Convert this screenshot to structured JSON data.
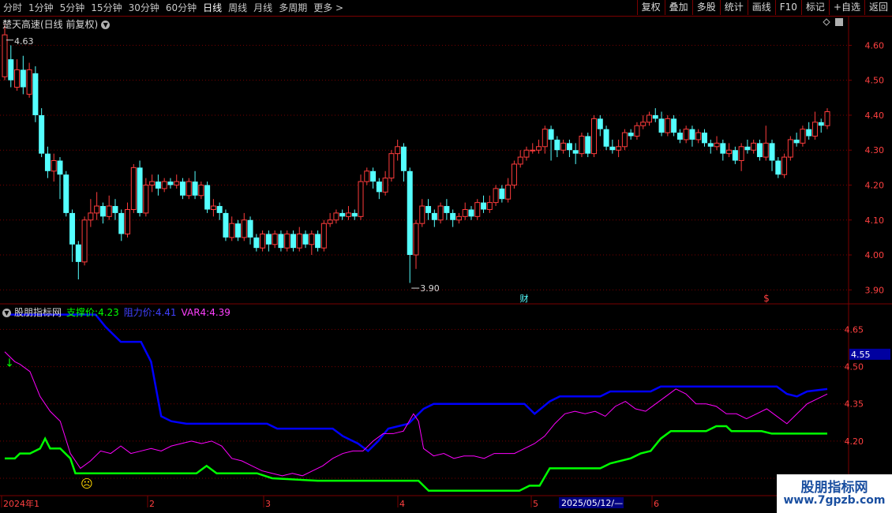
{
  "toolbar": {
    "periods": [
      "分时",
      "1分钟",
      "5分钟",
      "15分钟",
      "30分钟",
      "60分钟",
      "日线",
      "周线",
      "月线",
      "多周期",
      "更多 >"
    ],
    "active_index": 6,
    "right_buttons": [
      "复权",
      "叠加",
      "多股",
      "统计",
      "画线",
      "F10",
      "标记",
      "+自选",
      "返回"
    ]
  },
  "main": {
    "title": "楚天高速(日线 前复权)",
    "high_label": "4.63",
    "low_label": "3.90",
    "axis_ticks": [
      "4.60",
      "4.50",
      "4.40",
      "4.30",
      "4.20",
      "4.10",
      "4.00",
      "3.90"
    ],
    "marker_cai": "财",
    "marker_s": "$"
  },
  "indicator": {
    "name": "股朋指标网",
    "support_label": "支撑价:",
    "support_value": "4.23",
    "resist_label": "阻力价:",
    "resist_value": "4.41",
    "var4_label": "VAR4:",
    "var4_value": "4.39",
    "axis_ticks": [
      "4.65",
      "4.50",
      "4.35",
      "4.20",
      "4.05"
    ],
    "current_tag": "4.55",
    "face": "☹",
    "arrow": "↓"
  },
  "date_axis": {
    "labels": [
      "2024年1",
      "2",
      "3",
      "4",
      "5",
      "6"
    ],
    "highlight": "2025/05/12/—"
  },
  "watermark": {
    "line1": "股朋指标网",
    "line2": "www.7gpzb.com"
  },
  "colors": {
    "up": "#ff3c3c",
    "down": "#54ffff",
    "support": "#00ff00",
    "resist": "#0000ff",
    "var4": "#ff00ff",
    "grid": "#7a0000"
  },
  "chart_data": {
    "type": "candlestick",
    "price_range": [
      3.86,
      4.68
    ],
    "candles": [
      [
        4.51,
        4.63,
        4.66,
        4.5
      ],
      [
        4.56,
        4.5,
        4.6,
        4.48
      ],
      [
        4.48,
        4.53,
        4.56,
        4.47
      ],
      [
        4.53,
        4.48,
        4.57,
        4.46
      ],
      [
        4.46,
        4.53,
        4.55,
        4.45
      ],
      [
        4.52,
        4.4,
        4.54,
        4.38
      ],
      [
        4.4,
        4.29,
        4.42,
        4.28
      ],
      [
        4.29,
        4.24,
        4.31,
        4.22
      ],
      [
        4.24,
        4.27,
        4.29,
        4.21
      ],
      [
        4.27,
        4.23,
        4.28,
        4.16
      ],
      [
        4.23,
        4.12,
        4.24,
        4.11
      ],
      [
        4.12,
        4.03,
        4.13,
        3.98
      ],
      [
        4.03,
        3.98,
        4.04,
        3.93
      ],
      [
        3.98,
        4.1,
        4.11,
        3.97
      ],
      [
        4.1,
        4.12,
        4.16,
        4.08
      ],
      [
        4.12,
        4.14,
        4.18,
        4.1
      ],
      [
        4.14,
        4.11,
        4.15,
        4.09
      ],
      [
        4.11,
        4.14,
        4.17,
        4.1
      ],
      [
        4.14,
        4.12,
        4.16,
        4.1
      ],
      [
        4.12,
        4.06,
        4.13,
        4.04
      ],
      [
        4.06,
        4.13,
        4.15,
        4.05
      ],
      [
        4.13,
        4.25,
        4.26,
        4.12
      ],
      [
        4.25,
        4.12,
        4.27,
        4.11
      ],
      [
        4.12,
        4.2,
        4.22,
        4.11
      ],
      [
        4.2,
        4.21,
        4.23,
        4.18
      ],
      [
        4.21,
        4.19,
        4.23,
        4.17
      ],
      [
        4.19,
        4.21,
        4.22,
        4.18
      ],
      [
        4.21,
        4.2,
        4.22,
        4.19
      ],
      [
        4.2,
        4.21,
        4.23,
        4.19
      ],
      [
        4.21,
        4.17,
        4.22,
        4.16
      ],
      [
        4.17,
        4.21,
        4.22,
        4.16
      ],
      [
        4.21,
        4.17,
        4.24,
        4.16
      ],
      [
        4.17,
        4.2,
        4.21,
        4.16
      ],
      [
        4.2,
        4.13,
        4.21,
        4.12
      ],
      [
        4.13,
        4.14,
        4.16,
        4.11
      ],
      [
        4.14,
        4.12,
        4.15,
        4.1
      ],
      [
        4.12,
        4.05,
        4.13,
        4.04
      ],
      [
        4.05,
        4.09,
        4.11,
        4.04
      ],
      [
        4.09,
        4.05,
        4.1,
        4.04
      ],
      [
        4.05,
        4.1,
        4.12,
        4.04
      ],
      [
        4.1,
        4.05,
        4.11,
        4.03
      ],
      [
        4.05,
        4.02,
        4.06,
        4.01
      ],
      [
        4.02,
        4.06,
        4.07,
        4.01
      ],
      [
        4.06,
        4.03,
        4.07,
        4.01
      ],
      [
        4.03,
        4.06,
        4.07,
        4.02
      ],
      [
        4.06,
        4.02,
        4.07,
        4.01
      ],
      [
        4.02,
        4.06,
        4.07,
        4.01
      ],
      [
        4.06,
        4.02,
        4.07,
        4.01
      ],
      [
        4.02,
        4.06,
        4.08,
        4.01
      ],
      [
        4.06,
        4.03,
        4.07,
        4.02
      ],
      [
        4.03,
        4.06,
        4.07,
        4.0
      ],
      [
        4.06,
        4.02,
        4.07,
        4.01
      ],
      [
        4.02,
        4.09,
        4.1,
        4.01
      ],
      [
        4.09,
        4.1,
        4.12,
        4.08
      ],
      [
        4.1,
        4.12,
        4.13,
        4.09
      ],
      [
        4.12,
        4.11,
        4.13,
        4.1
      ],
      [
        4.11,
        4.12,
        4.14,
        4.1
      ],
      [
        4.12,
        4.11,
        4.13,
        4.1
      ],
      [
        4.11,
        4.21,
        4.23,
        4.1
      ],
      [
        4.21,
        4.24,
        4.25,
        4.2
      ],
      [
        4.24,
        4.21,
        4.25,
        4.19
      ],
      [
        4.21,
        4.18,
        4.22,
        4.16
      ],
      [
        4.18,
        4.22,
        4.24,
        4.17
      ],
      [
        4.22,
        4.29,
        4.3,
        4.21
      ],
      [
        4.29,
        4.31,
        4.33,
        4.27
      ],
      [
        4.31,
        4.24,
        4.32,
        4.21
      ],
      [
        4.24,
        4.0,
        4.25,
        3.92
      ],
      [
        4.0,
        4.09,
        4.1,
        3.96
      ],
      [
        4.09,
        4.14,
        4.16,
        4.08
      ],
      [
        4.14,
        4.12,
        4.16,
        4.1
      ],
      [
        4.12,
        4.1,
        4.13,
        4.08
      ],
      [
        4.1,
        4.14,
        4.15,
        4.09
      ],
      [
        4.14,
        4.12,
        4.16,
        4.1
      ],
      [
        4.12,
        4.1,
        4.13,
        4.08
      ],
      [
        4.1,
        4.11,
        4.12,
        4.09
      ],
      [
        4.11,
        4.13,
        4.15,
        4.1
      ],
      [
        4.13,
        4.11,
        4.14,
        4.1
      ],
      [
        4.11,
        4.15,
        4.16,
        4.1
      ],
      [
        4.15,
        4.13,
        4.17,
        4.12
      ],
      [
        4.13,
        4.15,
        4.17,
        4.12
      ],
      [
        4.15,
        4.19,
        4.2,
        4.14
      ],
      [
        4.19,
        4.16,
        4.2,
        4.15
      ],
      [
        4.16,
        4.2,
        4.22,
        4.15
      ],
      [
        4.2,
        4.26,
        4.27,
        4.19
      ],
      [
        4.26,
        4.28,
        4.3,
        4.25
      ],
      [
        4.28,
        4.3,
        4.31,
        4.27
      ],
      [
        4.3,
        4.3,
        4.32,
        4.29
      ],
      [
        4.3,
        4.31,
        4.33,
        4.29
      ],
      [
        4.31,
        4.36,
        4.37,
        4.29
      ],
      [
        4.36,
        4.33,
        4.37,
        4.27
      ],
      [
        4.33,
        4.3,
        4.34,
        4.28
      ],
      [
        4.3,
        4.32,
        4.33,
        4.29
      ],
      [
        4.32,
        4.3,
        4.33,
        4.28
      ],
      [
        4.3,
        4.29,
        4.32,
        4.26
      ],
      [
        4.29,
        4.34,
        4.35,
        4.28
      ],
      [
        4.34,
        4.29,
        4.35,
        4.28
      ],
      [
        4.29,
        4.39,
        4.4,
        4.28
      ],
      [
        4.39,
        4.36,
        4.4,
        4.34
      ],
      [
        4.36,
        4.31,
        4.37,
        4.3
      ],
      [
        4.31,
        4.3,
        4.33,
        4.29
      ],
      [
        4.3,
        4.31,
        4.33,
        4.28
      ],
      [
        4.31,
        4.35,
        4.36,
        4.3
      ],
      [
        4.35,
        4.34,
        4.36,
        4.33
      ],
      [
        4.34,
        4.37,
        4.38,
        4.33
      ],
      [
        4.37,
        4.38,
        4.4,
        4.36
      ],
      [
        4.38,
        4.4,
        4.41,
        4.37
      ],
      [
        4.4,
        4.39,
        4.42,
        4.38
      ],
      [
        4.39,
        4.35,
        4.41,
        4.34
      ],
      [
        4.35,
        4.39,
        4.4,
        4.34
      ],
      [
        4.39,
        4.35,
        4.4,
        4.34
      ],
      [
        4.35,
        4.33,
        4.36,
        4.32
      ],
      [
        4.33,
        4.36,
        4.37,
        4.32
      ],
      [
        4.36,
        4.33,
        4.37,
        4.31
      ],
      [
        4.33,
        4.35,
        4.36,
        4.32
      ],
      [
        4.35,
        4.32,
        4.36,
        4.31
      ],
      [
        4.32,
        4.31,
        4.33,
        4.29
      ],
      [
        4.31,
        4.32,
        4.34,
        4.3
      ],
      [
        4.32,
        4.29,
        4.33,
        4.27
      ],
      [
        4.29,
        4.3,
        4.32,
        4.28
      ],
      [
        4.3,
        4.27,
        4.31,
        4.26
      ],
      [
        4.27,
        4.31,
        4.32,
        4.24
      ],
      [
        4.31,
        4.3,
        4.33,
        4.29
      ],
      [
        4.3,
        4.32,
        4.33,
        4.29
      ],
      [
        4.32,
        4.28,
        4.33,
        4.27
      ],
      [
        4.28,
        4.32,
        4.37,
        4.27
      ],
      [
        4.32,
        4.27,
        4.33,
        4.24
      ],
      [
        4.27,
        4.23,
        4.28,
        4.22
      ],
      [
        4.23,
        4.28,
        4.29,
        4.22
      ],
      [
        4.28,
        4.33,
        4.34,
        4.27
      ],
      [
        4.33,
        4.32,
        4.35,
        4.31
      ],
      [
        4.32,
        4.36,
        4.37,
        4.31
      ],
      [
        4.36,
        4.34,
        4.38,
        4.33
      ],
      [
        4.34,
        4.38,
        4.41,
        4.33
      ],
      [
        4.38,
        4.37,
        4.39,
        4.35
      ],
      [
        4.37,
        4.41,
        4.42,
        4.36
      ]
    ],
    "indicator_range": [
      3.98,
      4.75
    ],
    "series": [
      {
        "name": "支撑价",
        "values": [
          4.13,
          4.13,
          4.15,
          4.15,
          4.17,
          4.21,
          4.17,
          4.17,
          4.17,
          4.15,
          4.11,
          4.07,
          4.07,
          4.07,
          4.07,
          4.07,
          4.07,
          4.07,
          4.07,
          4.07,
          4.07,
          4.07,
          4.07,
          4.07,
          4.07,
          4.07,
          4.07,
          4.07,
          4.07,
          4.07,
          4.07,
          4.07,
          4.07,
          4.07,
          4.07,
          4.07,
          4.07,
          4.07,
          4.07,
          4.07,
          4.07,
          4.07,
          4.07,
          4.07,
          4.07,
          4.07,
          4.07,
          4.07,
          4.07,
          4.07,
          4.07,
          4.07,
          4.07,
          4.07,
          4.07,
          4.07,
          4.07,
          4.07,
          4.07,
          4.07,
          4.07,
          4.07,
          4.07,
          4.07,
          4.07,
          4.07,
          4.07,
          4.07,
          4.07,
          4.07,
          4.07,
          4.07,
          4.07,
          4.07,
          4.07,
          4.07,
          4.07,
          4.07,
          4.07,
          4.07,
          4.07,
          4.07,
          4.07,
          4.07,
          4.07,
          4.07,
          4.07,
          4.07,
          4.07,
          4.07,
          4.07,
          4.07,
          4.07,
          4.07,
          4.07,
          4.07,
          4.07,
          4.07,
          4.07,
          4.07,
          4.07,
          4.07,
          4.07,
          4.07,
          4.07,
          4.07,
          4.07,
          4.07,
          4.07,
          4.07,
          4.07,
          4.07,
          4.07,
          4.07,
          4.07,
          4.07,
          4.07,
          4.07,
          4.07,
          4.07,
          4.07,
          4.07,
          4.07,
          4.07,
          4.07,
          4.07,
          4.07,
          4.07,
          4.07,
          4.07,
          4.07,
          4.07,
          4.07,
          4.07,
          4.07,
          4.07,
          4.07,
          4.07,
          4.07
        ]
      },
      {
        "name": "阻力价",
        "values": []
      },
      {
        "name": "VAR4",
        "values": []
      }
    ]
  }
}
